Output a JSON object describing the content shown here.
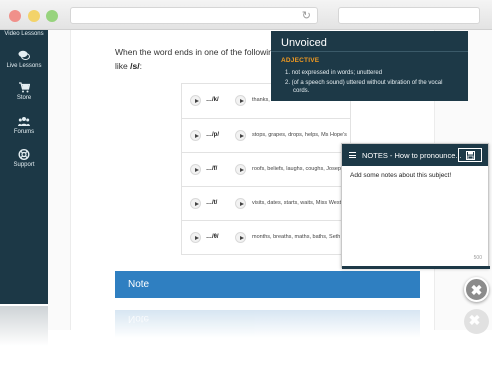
{
  "sidebar": {
    "items": [
      {
        "label": "Video Lessons",
        "icon": "video-icon"
      },
      {
        "label": "Live Lessons",
        "icon": "chat-bubbles-icon"
      },
      {
        "label": "Store",
        "icon": "cart-icon"
      },
      {
        "label": "Forums",
        "icon": "users-icon"
      },
      {
        "label": "Support",
        "icon": "lifebuoy-icon"
      }
    ]
  },
  "lesson": {
    "intro_line1": "When the word ends in one of the following",
    "intro_line2_pre": "like ",
    "intro_line2_sound": "/s/",
    "intro_line2_post": ":",
    "rows": [
      {
        "sound": "…/k/",
        "examples": "thanks, "
      },
      {
        "sound": "…/p/",
        "examples": "stops, grapes, drops, helps, Ms Hope's"
      },
      {
        "sound": "…/f/",
        "examples": "roofs, beliefs, laughs, coughs, Joseph"
      },
      {
        "sound": "…/t/",
        "examples": "visits, dates, starts, waits, Miss West"
      },
      {
        "sound": "…/θ/",
        "examples": "months, breaths, maths, baths, Seth"
      }
    ],
    "note_label": "Note"
  },
  "dictionary": {
    "word": "Unvoiced",
    "part_of_speech": "ADJECTIVE",
    "definitions": [
      "1.  not expressed in words; unuttered",
      "2.  (of a speech sound) uttered without vibration of the vocal",
      "cords."
    ]
  },
  "notes": {
    "title": "NOTES - How to pronounce...",
    "placeholder": "Add some notes about this subject!",
    "char_count": "500"
  },
  "colors": {
    "sidebar": "#1c3846",
    "accent_orange": "#f39a1f",
    "note_blue": "#2f7fc1"
  }
}
